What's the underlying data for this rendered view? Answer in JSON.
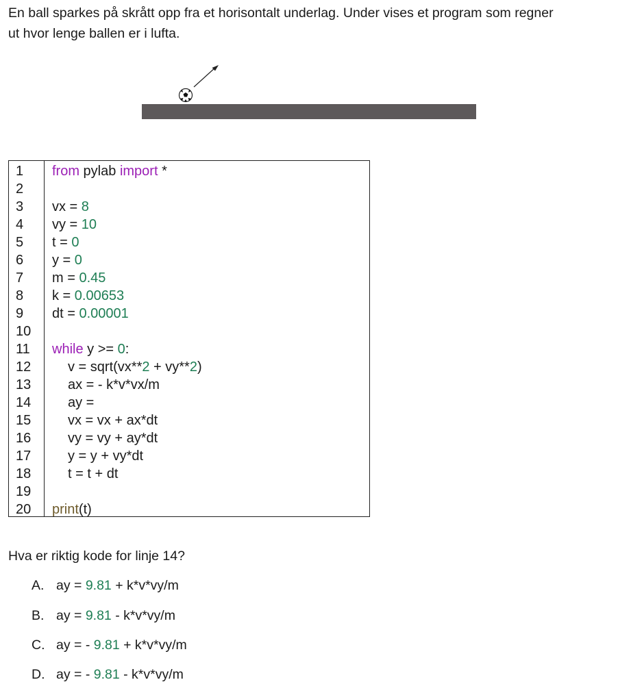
{
  "intro": {
    "line1": "En ball sparkes på skrått opp fra et horisontalt underlag. Under vises et program som regner",
    "line2": "ut hvor lenge ballen er i lufta."
  },
  "code": {
    "line_numbers": [
      "1",
      "2",
      "3",
      "4",
      "5",
      "6",
      "7",
      "8",
      "9",
      "10",
      "11",
      "12",
      "13",
      "14",
      "15",
      "16",
      "17",
      "18",
      "19",
      "20"
    ],
    "l1_from": "from",
    "l1_mod": " pylab ",
    "l1_import": "import",
    "l1_star": " *",
    "l3_a": "vx = ",
    "l3_b": "8",
    "l4_a": "vy = ",
    "l4_b": "10",
    "l5_a": "t = ",
    "l5_b": "0",
    "l6_a": "y = ",
    "l6_b": "0",
    "l7_a": "m = ",
    "l7_b": "0.45",
    "l8_a": "k = ",
    "l8_b": "0.00653",
    "l9_a": "dt = ",
    "l9_b": "0.00001",
    "l11_kw": "while",
    "l11_a": " y >= ",
    "l11_b": "0",
    "l11_c": ":",
    "l12_a": "v = sqrt(vx**",
    "l12_b": "2",
    "l12_c": " + vy**",
    "l12_d": "2",
    "l12_e": ")",
    "l13": "ax = - k*v*vx/m",
    "l14": "ay =",
    "l15": "vx = vx + ax*dt",
    "l16": "vy = vy + ay*dt",
    "l17": "y = y + vy*dt",
    "l18": "t = t + dt",
    "l20_fn": "print",
    "l20_a": "(t)"
  },
  "question": "Hva er riktig kode for linje 14?",
  "options": [
    {
      "letter": "A.",
      "pre": "ay = ",
      "num": "9.81",
      "post": " + k*v*vy/m"
    },
    {
      "letter": "B.",
      "pre": "ay = ",
      "num": "9.81",
      "post": " - k*v*vy/m"
    },
    {
      "letter": "C.",
      "pre": "ay = - ",
      "num": "9.81",
      "post": " + k*v*vy/m"
    },
    {
      "letter": "D.",
      "pre": "ay = - ",
      "num": "9.81",
      "post": " - k*v*vy/m"
    }
  ],
  "colors": {
    "keyword": "#9b1fb5",
    "number": "#1e7e54",
    "function": "#6d5a2a",
    "ground": "#5d595a"
  },
  "icons": {
    "ball": "soccer-ball-icon",
    "arrow": "arrow-up-right-icon"
  }
}
